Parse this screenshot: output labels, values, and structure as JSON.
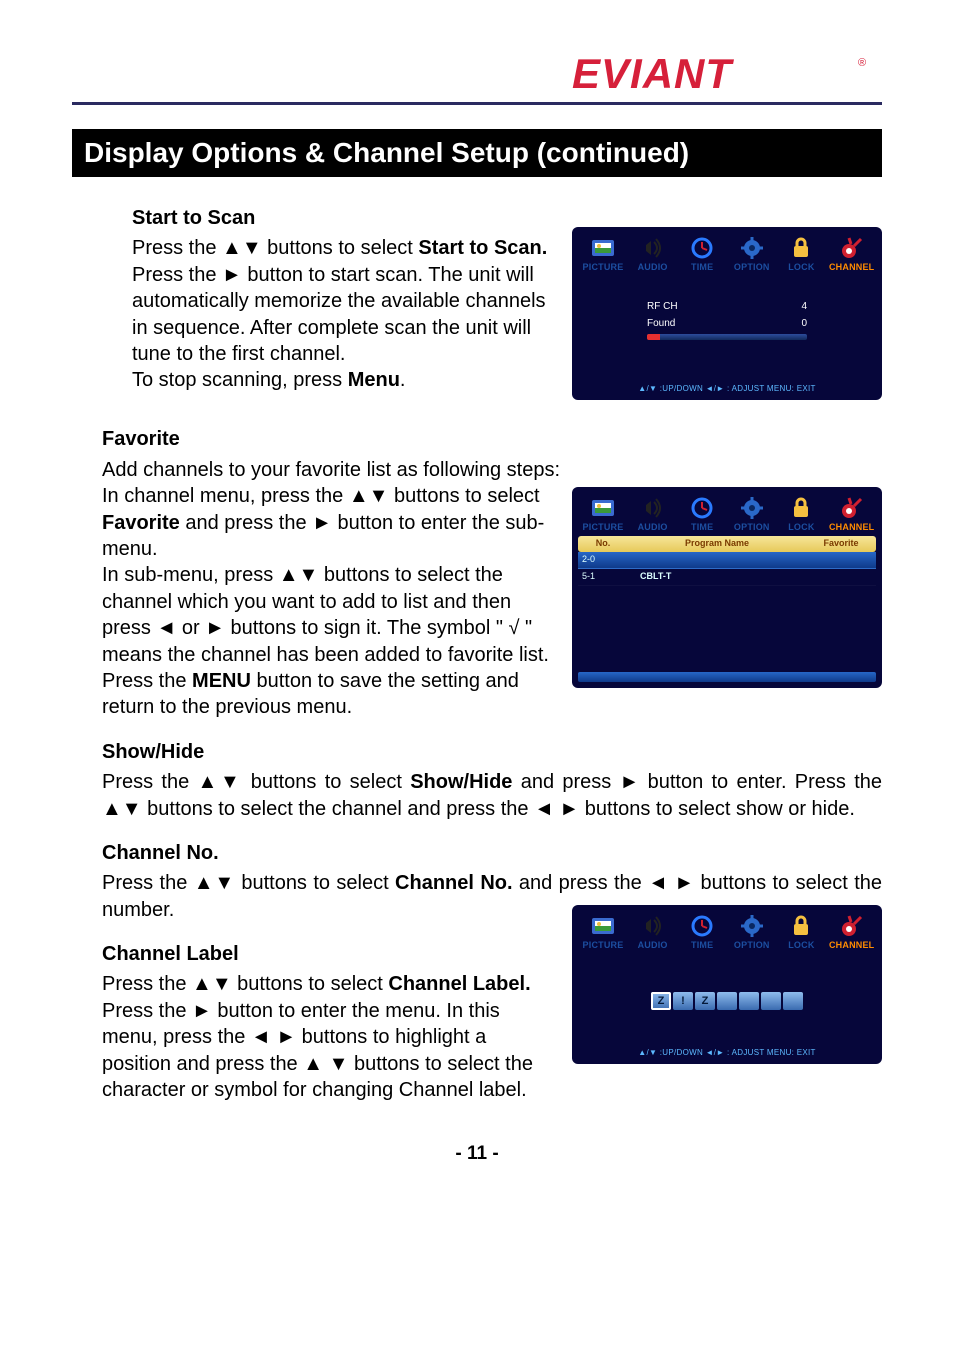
{
  "brand": "EVIANT",
  "section_title": "Display Options & Channel Setup (continued)",
  "start_to_scan": {
    "heading": "Start to Scan",
    "p1a": "Press the ▲▼ buttons to select ",
    "p1b": "Start to Scan.",
    "p1c": " Press the ► button to start scan. The unit will automatically memorize the available channels in sequence. After complete scan the unit will tune to the first channel.",
    "p2a": "To stop scanning, press ",
    "p2b": "Menu",
    "p2c": "."
  },
  "favorite": {
    "heading": "Favorite",
    "p1": "Add channels to your favorite list as following steps:",
    "p2a": "In channel menu, press the ▲▼ buttons to select ",
    "p2b": "Favorite",
    "p2c": " and press the ► button to enter the sub-menu.",
    "p3a": "In sub-menu, press ▲▼ buttons to select the channel which you want to add to list and then press ◄ or ► buttons to sign it. The symbol \" √ \" means the channel has been added to favorite list. Press the ",
    "p3b": "MENU",
    "p3c": " button to save the setting and return to the previous menu."
  },
  "showhide": {
    "heading": "Show/Hide",
    "p1a": "Press the ▲▼ buttons to select ",
    "p1b": "Show/Hide",
    "p1c": " and press ► button to enter. Press the ▲▼ buttons to select the channel and press the ◄ ► buttons to select show or hide."
  },
  "channelno": {
    "heading": "Channel No.",
    "p1a": "Press the ▲▼ buttons to select ",
    "p1b": "Channel No.",
    "p1c": " and press the ◄ ► buttons to select the number."
  },
  "channellabel": {
    "heading": "Channel Label",
    "p1a": "Press the ▲▼ buttons to select ",
    "p1b": "Channel Label.",
    "p1c": " Press the ► button to enter the menu. In this menu, press the ◄ ► buttons to highlight a position and press the ▲ ▼ buttons to select the character or symbol for changing Channel label."
  },
  "osd_tabs": [
    {
      "label": "PICTURE",
      "icon": "picture"
    },
    {
      "label": "AUDIO",
      "icon": "audio"
    },
    {
      "label": "TIME",
      "icon": "time"
    },
    {
      "label": "OPTION",
      "icon": "option"
    },
    {
      "label": "LOCK",
      "icon": "lock"
    },
    {
      "label": "CHANNEL",
      "icon": "channel",
      "active": true
    }
  ],
  "osd_scan": {
    "rfch_label": "RF CH",
    "rfch_value": "4",
    "found_label": "Found",
    "found_value": "0",
    "footer": "▲/▼ :UP/DOWN  ◄/► : ADJUST    MENU: EXIT"
  },
  "osd_fav": {
    "col_no": "No.",
    "col_prog": "Program Name",
    "col_fav": "Favorite",
    "rows": [
      {
        "no": "2-0",
        "name": "",
        "sel": true
      },
      {
        "no": "5-1",
        "name": "CBLT-T",
        "sel": false
      }
    ]
  },
  "osd_label": {
    "boxes": [
      "Z",
      "!",
      "Z",
      "",
      "",
      "",
      ""
    ],
    "footer": "▲/▼ :UP/DOWN  ◄/► : ADJUST    MENU: EXIT"
  },
  "page_number": "- 11 -"
}
